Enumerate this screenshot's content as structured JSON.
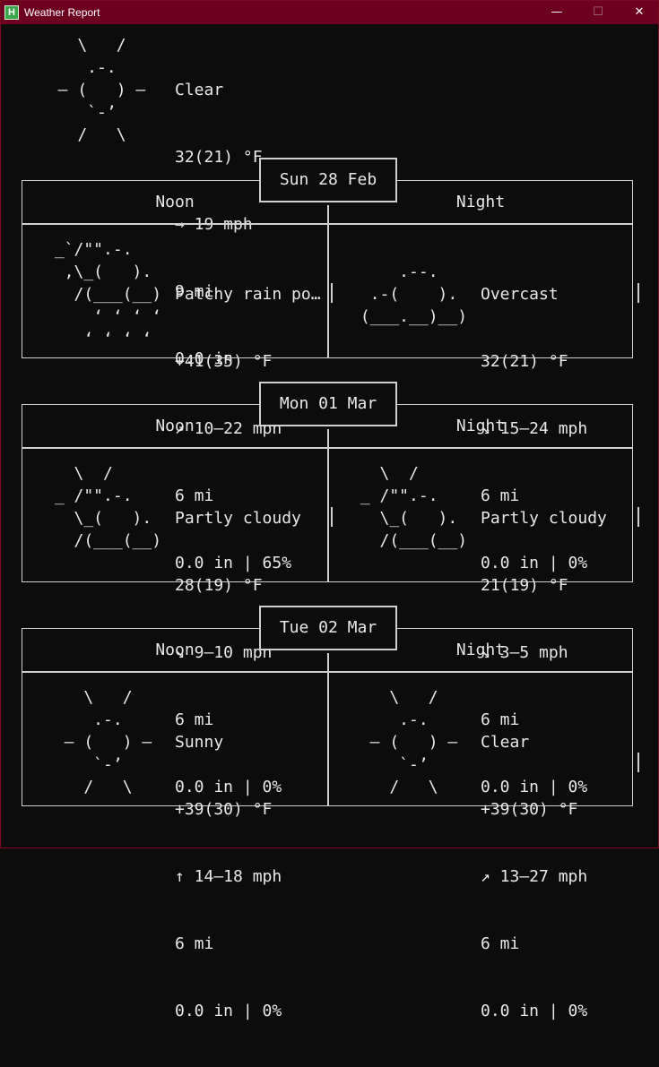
{
  "window": {
    "title": "Weather Report",
    "icon_glyph": "H",
    "controls": {
      "minimize": "—",
      "maximize": "☐",
      "close": "✕"
    }
  },
  "current": {
    "ascii": "    \\   /   \n     .-.    \n  ― (   ) ― \n     `-’    \n    /   \\   ",
    "condition": "Clear",
    "temp": "32(21) °F",
    "wind": "→ 19 mph",
    "visibility": "9 mi",
    "precip": "0.0 in"
  },
  "days": [
    {
      "date": "Sun 28 Feb",
      "noon": {
        "label": "Noon",
        "ascii": " _`/\"\".-.    \n  ,\\_(   ).  \n   /(___(__) \n     ‘ ‘ ‘ ‘ \n    ‘ ‘ ‘ ‘  ",
        "condition": "Patchy rain po…",
        "temp": "+41(35) °F",
        "wind": "↗ 10–22 mph",
        "visibility": "6 mi",
        "precip": "0.0 in | 65%"
      },
      "night": {
        "label": "Night",
        "ascii": "             \n     .--.    \n  .-(    ).  \n (___.__)__) \n             ",
        "condition": "Overcast",
        "temp": "32(21) °F",
        "wind": "↘ 15–24 mph",
        "visibility": "6 mi",
        "precip": "0.0 in | 0%"
      }
    },
    {
      "date": "Mon 01 Mar",
      "noon": {
        "label": "Noon",
        "ascii": "   \\  /      \n _ /\"\".-.    \n   \\_(   ).  \n   /(___(__) \n             ",
        "condition": "Partly cloudy",
        "temp": "28(19) °F",
        "wind": "↘ 9–10 mph",
        "visibility": "6 mi",
        "precip": "0.0 in | 0%"
      },
      "night": {
        "label": "Night",
        "ascii": "   \\  /      \n _ /\"\".-.    \n   \\_(   ).  \n   /(___(__) \n             ",
        "condition": "Partly cloudy",
        "temp": "21(19) °F",
        "wind": "↘ 3–5 mph",
        "visibility": "6 mi",
        "precip": "0.0 in | 0%"
      }
    },
    {
      "date": "Tue 02 Mar",
      "noon": {
        "label": "Noon",
        "ascii": "    \\   /    \n     .-.     \n  ― (   ) ―  \n     `-’     \n    /   \\    ",
        "condition": "Sunny",
        "temp": "+39(30) °F",
        "wind": "↑ 14–18 mph",
        "visibility": "6 mi",
        "precip": "0.0 in | 0%"
      },
      "night": {
        "label": "Night",
        "ascii": "    \\   /    \n     .-.     \n  ― (   ) ―  \n     `-’     \n    /   \\    ",
        "condition": "Clear",
        "temp": "+39(30) °F",
        "wind": "↗ 13–27 mph",
        "visibility": "6 mi",
        "precip": "0.0 in | 0%"
      }
    }
  ]
}
